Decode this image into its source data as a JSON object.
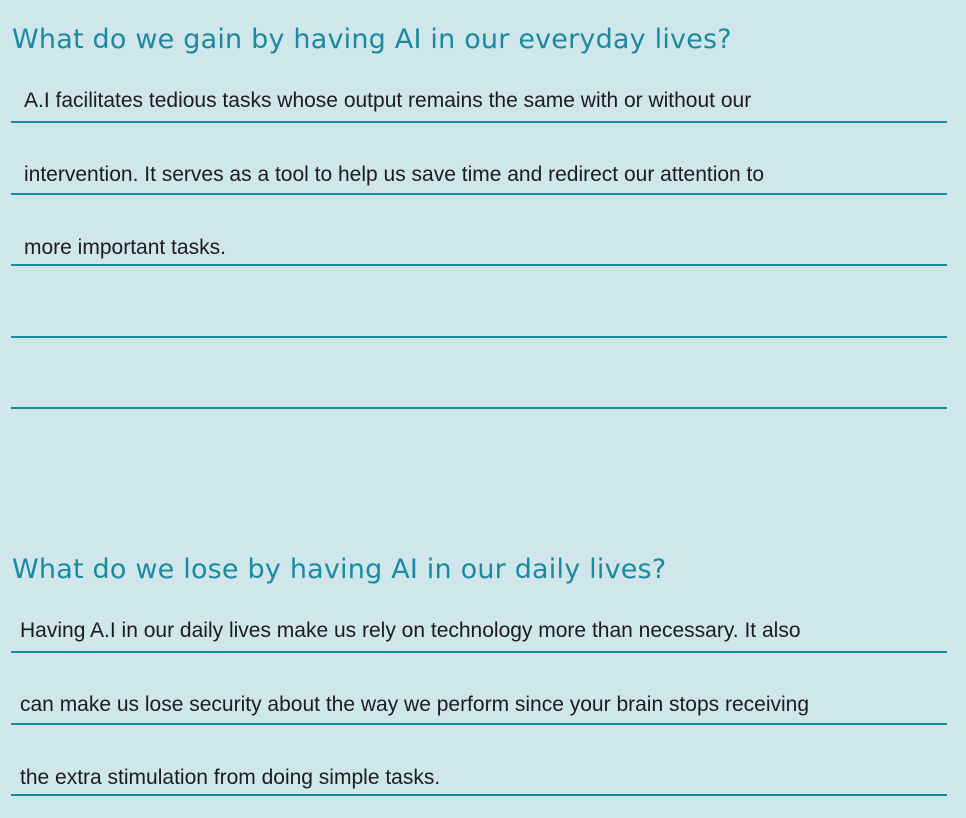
{
  "section1": {
    "heading": "What do we gain by having AI in our everyday lives?",
    "lines": [
      "A.I facilitates tedious tasks whose output remains the same with or without our",
      "intervention. It serves as a tool to help us save time and redirect our attention to",
      "more important tasks.",
      "",
      ""
    ]
  },
  "section2": {
    "heading": "What do we lose by having AI in our daily lives?",
    "lines": [
      "Having A.I in our daily lives make us rely on technology more than necessary. It also",
      "can make us lose security about the way we perform since your brain stops receiving",
      "the extra stimulation from doing simple tasks."
    ]
  }
}
